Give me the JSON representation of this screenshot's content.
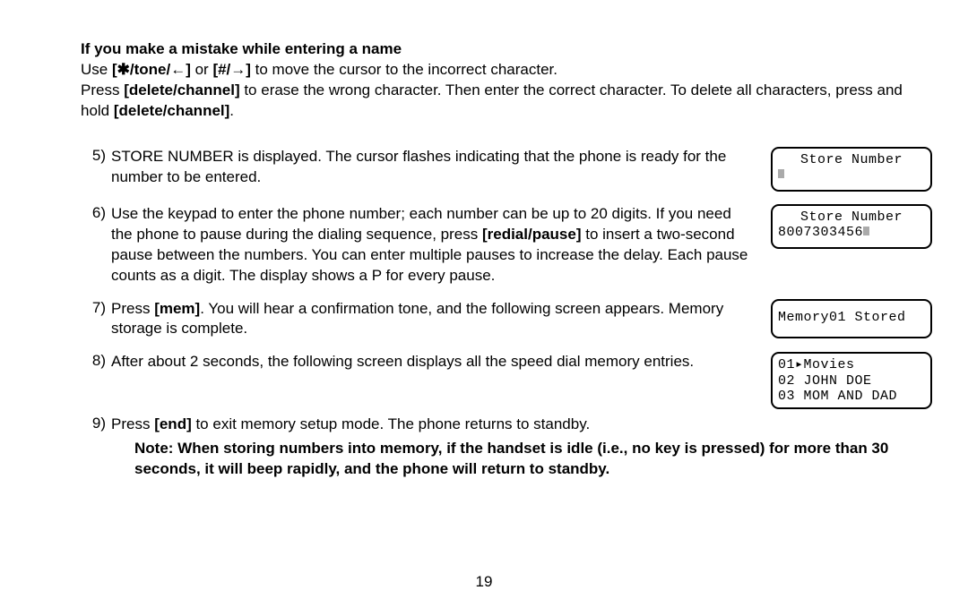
{
  "intro": {
    "heading": "If you make a mistake while entering a name",
    "line2_pre": "Use ",
    "key_star": "[✱/tone/←]",
    "line2_mid": " or ",
    "key_hash": "[#/→]",
    "line2_post": " to move the cursor to the incorrect character.",
    "line3_pre": "Press ",
    "key_delete": "[delete/channel]",
    "line3_mid": " to erase the wrong character. Then enter the correct character. To delete all characters, press and hold ",
    "key_delete2": "[delete/channel]",
    "line3_end": "."
  },
  "steps": {
    "s5": {
      "num": "5)",
      "text": "STORE NUMBER is displayed. The cursor flashes indicating that the phone is ready for the number to be entered.",
      "lcd_line1": "Store Number"
    },
    "s6": {
      "num": "6)",
      "text_pre": "Use the keypad to enter the phone number; each number can be up to 20 digits. If you need the phone to pause during the dialing sequence, press ",
      "key": "[redial/pause]",
      "text_post": " to insert a two-second pause between the numbers. You can enter multiple pauses to increase the delay. Each pause counts as a digit. The display shows a P for every pause.",
      "lcd_line1": "Store Number",
      "lcd_line2": "8007303456"
    },
    "s7": {
      "num": "7)",
      "text_pre": "Press ",
      "key": "[mem]",
      "text_post": ". You will hear a confirmation tone, and the following screen appears. Memory storage is complete.",
      "lcd_line1": "Memory01 Stored"
    },
    "s8": {
      "num": "8)",
      "text": "After about 2 seconds, the following screen displays all the speed dial memory entries.",
      "lcd_line1": "01▸Movies",
      "lcd_line2": "02 JOHN DOE",
      "lcd_line3": "03 MOM AND DAD"
    },
    "s9": {
      "num": "9)",
      "text_pre": "Press ",
      "key": "[end]",
      "text_post": " to exit memory setup mode. The phone returns to standby."
    }
  },
  "note": "Note: When storing numbers into memory, if the handset is idle (i.e., no key is pressed) for more than 30 seconds, it will beep rapidly, and the phone will return to standby.",
  "page_number": "19"
}
